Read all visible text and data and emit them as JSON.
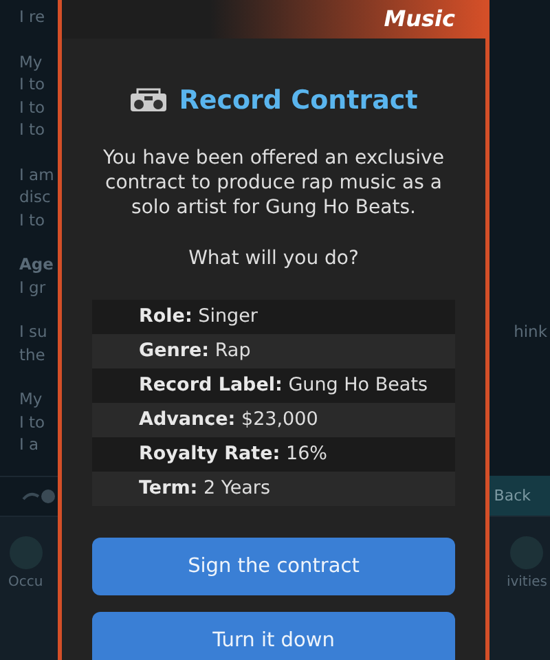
{
  "background": {
    "lines": [
      {
        "kind": "text",
        "left": "I re"
      },
      {
        "kind": "gap"
      },
      {
        "kind": "text",
        "left": "My"
      },
      {
        "kind": "text",
        "left": "I to"
      },
      {
        "kind": "text",
        "left": "I to"
      },
      {
        "kind": "text",
        "left": "I to"
      },
      {
        "kind": "gap"
      },
      {
        "kind": "text",
        "left": "I am"
      },
      {
        "kind": "text",
        "left": "disc"
      },
      {
        "kind": "text",
        "left": "I to"
      },
      {
        "kind": "gap"
      },
      {
        "kind": "heading",
        "left": "Age"
      },
      {
        "kind": "text",
        "left": "I gr"
      },
      {
        "kind": "gap"
      },
      {
        "kind": "text",
        "left": "I su",
        "right": "hink"
      },
      {
        "kind": "text",
        "left": "the"
      },
      {
        "kind": "gap"
      },
      {
        "kind": "text",
        "left": "My"
      },
      {
        "kind": "text",
        "left": "I to"
      },
      {
        "kind": "text",
        "left": "I a"
      }
    ],
    "back_button": "Back",
    "tabs": [
      {
        "label": "Occu"
      },
      {
        "label": "ivities"
      }
    ]
  },
  "modal": {
    "category": "Music",
    "title": "Record Contract",
    "description": "You have been offered an exclusive contract to produce rap music as a solo artist for Gung Ho Beats.",
    "question": "What will you do?",
    "details": [
      {
        "label": "Role:",
        "value": "Singer"
      },
      {
        "label": "Genre:",
        "value": "Rap"
      },
      {
        "label": "Record Label:",
        "value": "Gung Ho Beats"
      },
      {
        "label": "Advance:",
        "value": "$23,000"
      },
      {
        "label": "Royalty Rate:",
        "value": "16%"
      },
      {
        "label": "Term:",
        "value": "2 Years"
      }
    ],
    "buttons": [
      "Sign the contract",
      "Turn it down"
    ]
  }
}
